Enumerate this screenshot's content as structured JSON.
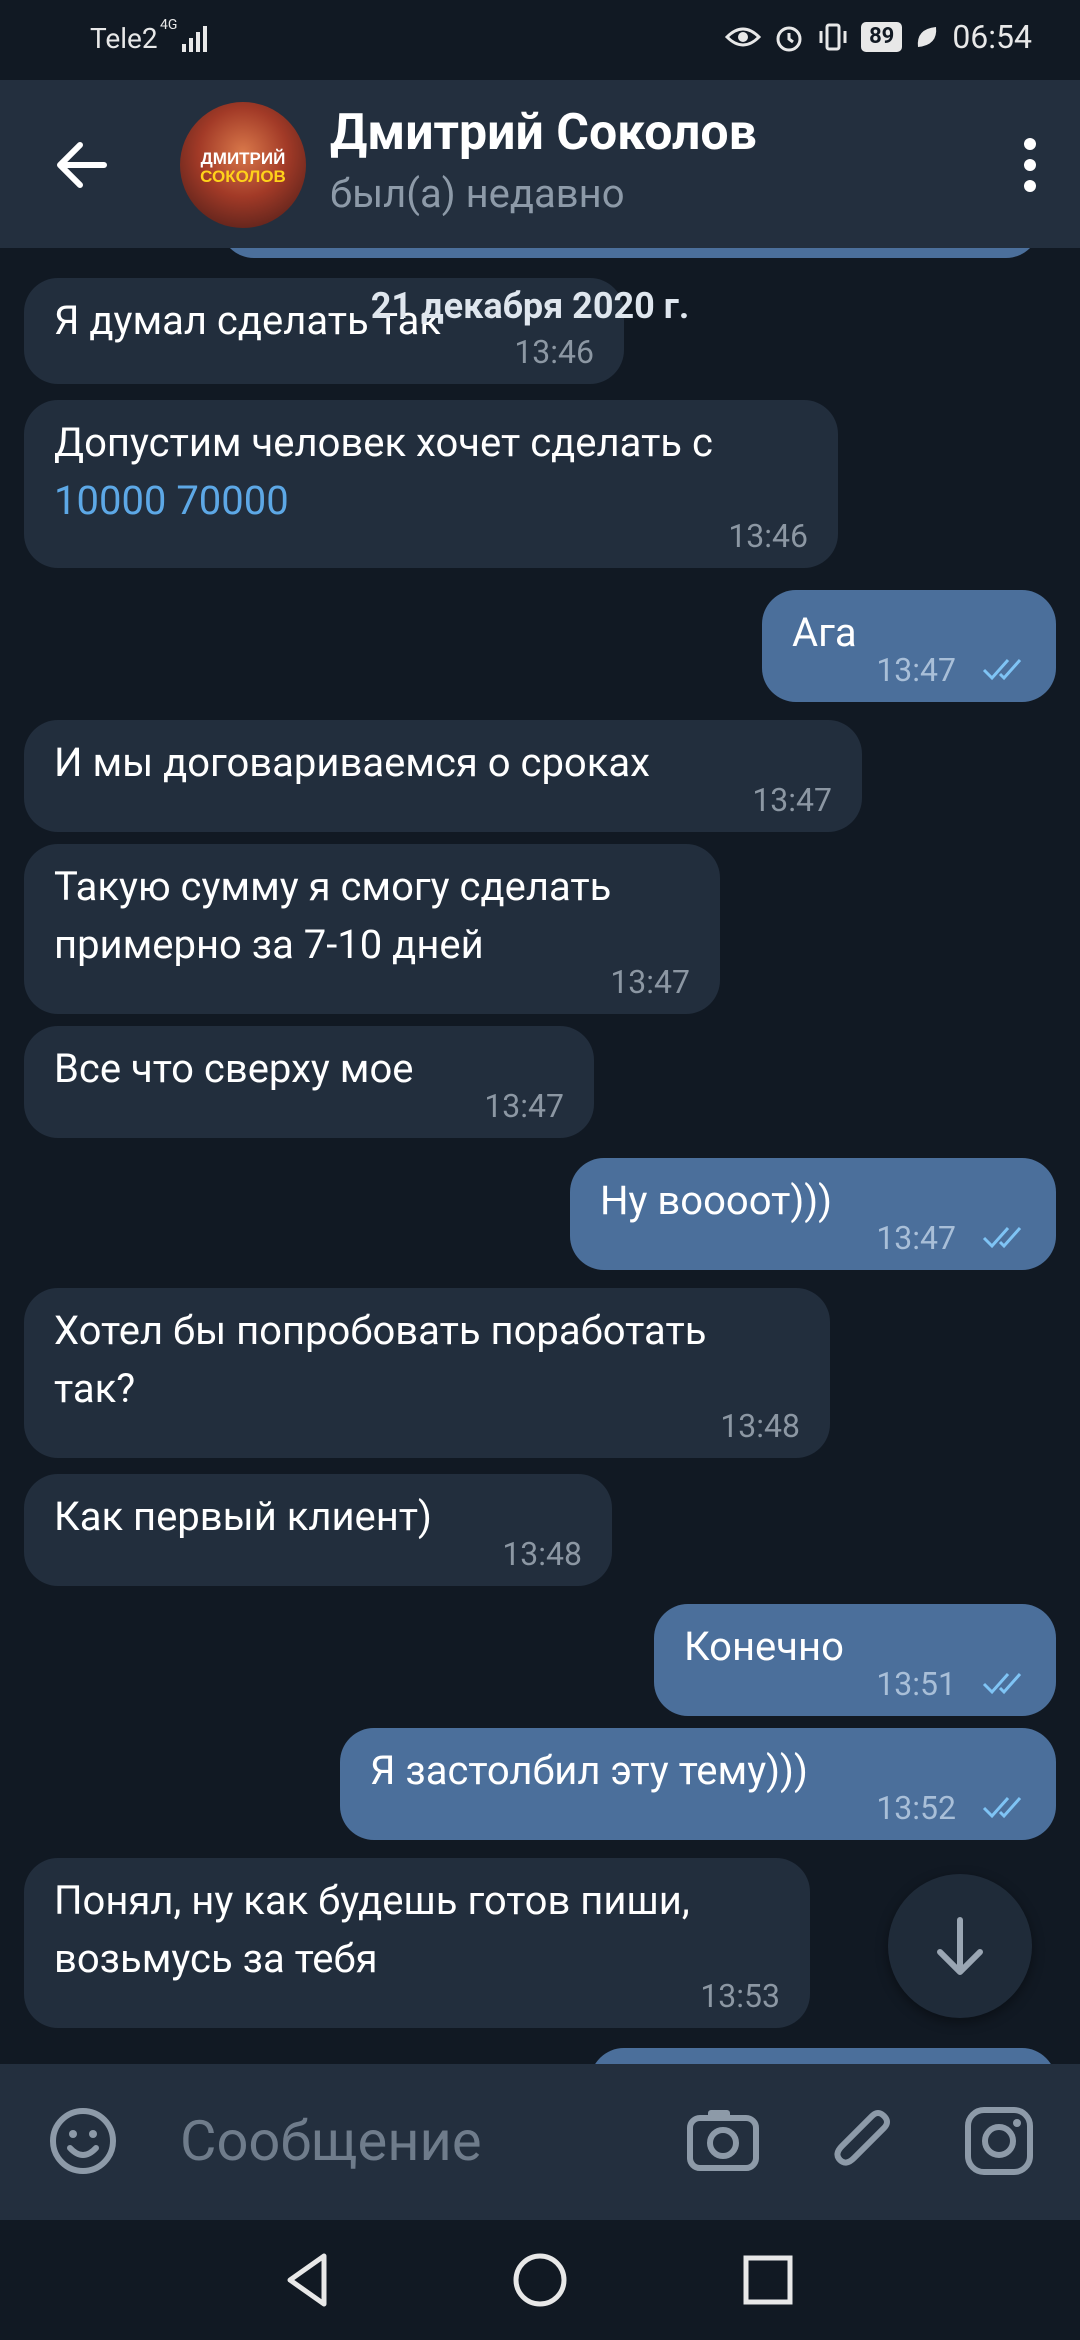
{
  "status_bar": {
    "carrier": "Tele2",
    "network": "4G",
    "battery": "89",
    "time": "06:54"
  },
  "header": {
    "contact_name": "Дмитрий Соколов",
    "status": "был(а) недавно",
    "avatar_text_line1": "ДМИТРИЙ",
    "avatar_text_line2": "СОКОЛОВ"
  },
  "chat": {
    "date_separator": "21 декабря 2020 г.",
    "messages": [
      {
        "direction": "in",
        "text": "Я думал сделать так",
        "time": "13:46"
      },
      {
        "direction": "in",
        "text_prefix": "Допустим человек хочет сделать с",
        "link": "10000 70000",
        "time": "13:46"
      },
      {
        "direction": "out",
        "text": "Ага",
        "time": "13:47",
        "read": true
      },
      {
        "direction": "in",
        "text": "И мы договариваемся о сроках",
        "time": "13:47"
      },
      {
        "direction": "in",
        "line1": "Такую сумму я смогу сделать",
        "line2": "примерно за 7-10 дней",
        "time": "13:47"
      },
      {
        "direction": "in",
        "text": "Все что сверху мое",
        "time": "13:47"
      },
      {
        "direction": "out",
        "text": "Ну вооoот)))",
        "time": "13:47",
        "read": true
      },
      {
        "direction": "in",
        "line1": "Хотел бы попробовать поработать",
        "line2": "так?",
        "time": "13:48"
      },
      {
        "direction": "in",
        "text": "Как первый клиент)",
        "time": "13:48"
      },
      {
        "direction": "out",
        "text": "Конечно",
        "time": "13:51",
        "read": true
      },
      {
        "direction": "out",
        "text": "Я застолбил эту тему)))",
        "time": "13:52",
        "read": true
      },
      {
        "direction": "in",
        "line1": "Понял, ну как будешь готов пиши,",
        "line2": "возьмусь за тебя",
        "time": "13:53"
      }
    ]
  },
  "input": {
    "placeholder": "Сообщение"
  },
  "icons": {
    "back": "arrow-left-icon",
    "menu": "more-vertical-icon",
    "emoji": "smile-icon",
    "camera": "camera-icon",
    "attach": "paperclip-icon",
    "instagram": "instagram-icon",
    "scroll_down": "arrow-down-icon"
  },
  "colors": {
    "background": "#111923",
    "header": "#232f3e",
    "incoming_bubble": "#222e3d",
    "outgoing_bubble": "#4b6f9b",
    "link": "#5da8e6",
    "check": "#7fc4f5"
  }
}
